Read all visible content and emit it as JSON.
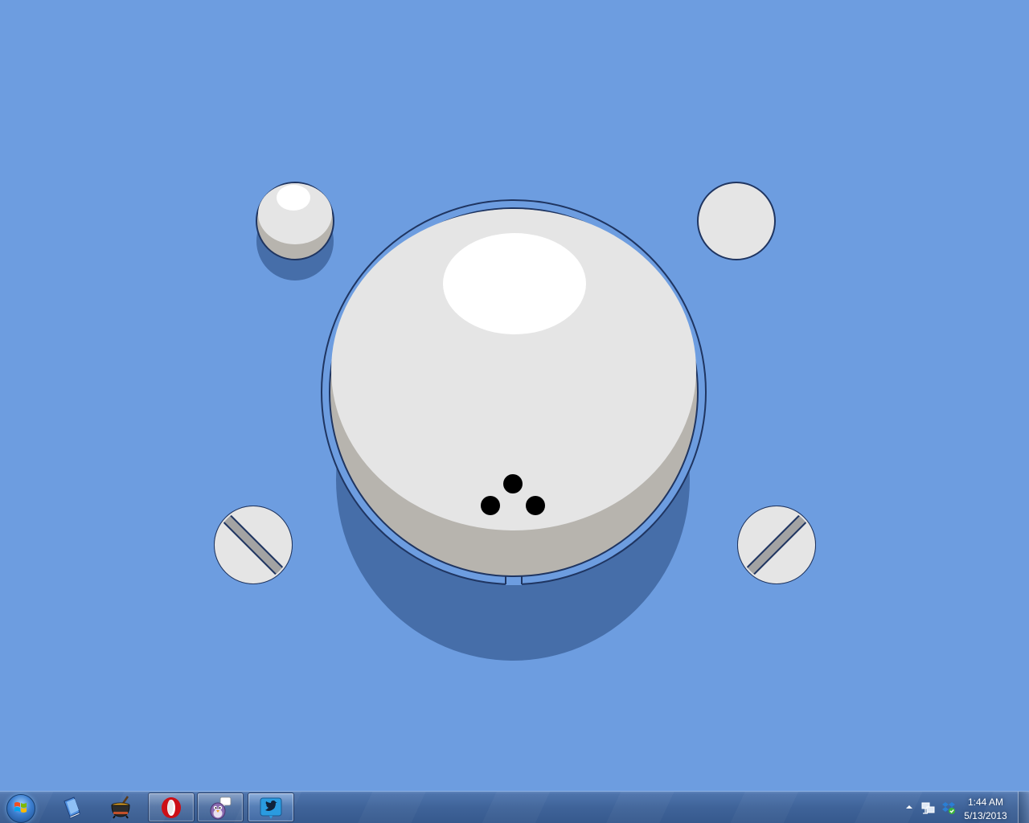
{
  "desktop": {
    "background_color": "#6d9de0",
    "wallpaper_name": "knob-wallpaper"
  },
  "taskbar": {
    "start_icon": "windows-start-orb",
    "pinned": [
      {
        "name": "notebook-app",
        "icon": "blue-book-icon"
      },
      {
        "name": "cauldron-app",
        "icon": "cauldron-icon"
      }
    ],
    "running": [
      {
        "name": "opera-browser",
        "icon": "opera-icon"
      },
      {
        "name": "pidgin-messenger",
        "icon": "pidgin-icon"
      },
      {
        "name": "twitter-client",
        "icon": "twitter-bird-icon",
        "active": true
      }
    ],
    "tray": {
      "expand_icon": "chevron-up-icon",
      "icons": [
        "network-icon",
        "dropbox-icon"
      ]
    },
    "clock": {
      "time": "1:44 AM",
      "date": "5/13/2013"
    }
  }
}
